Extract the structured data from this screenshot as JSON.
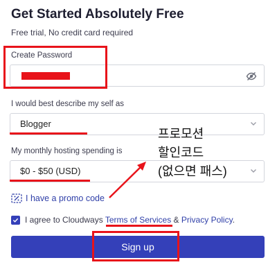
{
  "header": {
    "title": "Get Started Absolutely Free",
    "subtitle": "Free trial, No credit card required"
  },
  "password": {
    "label": "Create Password",
    "toggle_icon": "eye-slash-icon"
  },
  "describe": {
    "label": "I would best describe my self as",
    "value": "Blogger"
  },
  "spending": {
    "label": "My monthly hosting spending is",
    "value": "$0 - $50 (USD)"
  },
  "promo": {
    "label": "I have a promo code",
    "icon": "tag-icon"
  },
  "agreement": {
    "prefix": "I agree to Cloudways ",
    "terms": "Terms of Services",
    "and": " & ",
    "privacy": "Privacy Policy",
    "suffix": ".",
    "checked": true
  },
  "signup_label": "Sign up",
  "annotation": {
    "line1": "프로모션",
    "line2": "할인코드",
    "line3": "(없으면 패스)",
    "color": "#e8131a"
  },
  "colors": {
    "accent": "#3440b9",
    "link": "#2f3fa8",
    "highlight": "#e8131a"
  }
}
